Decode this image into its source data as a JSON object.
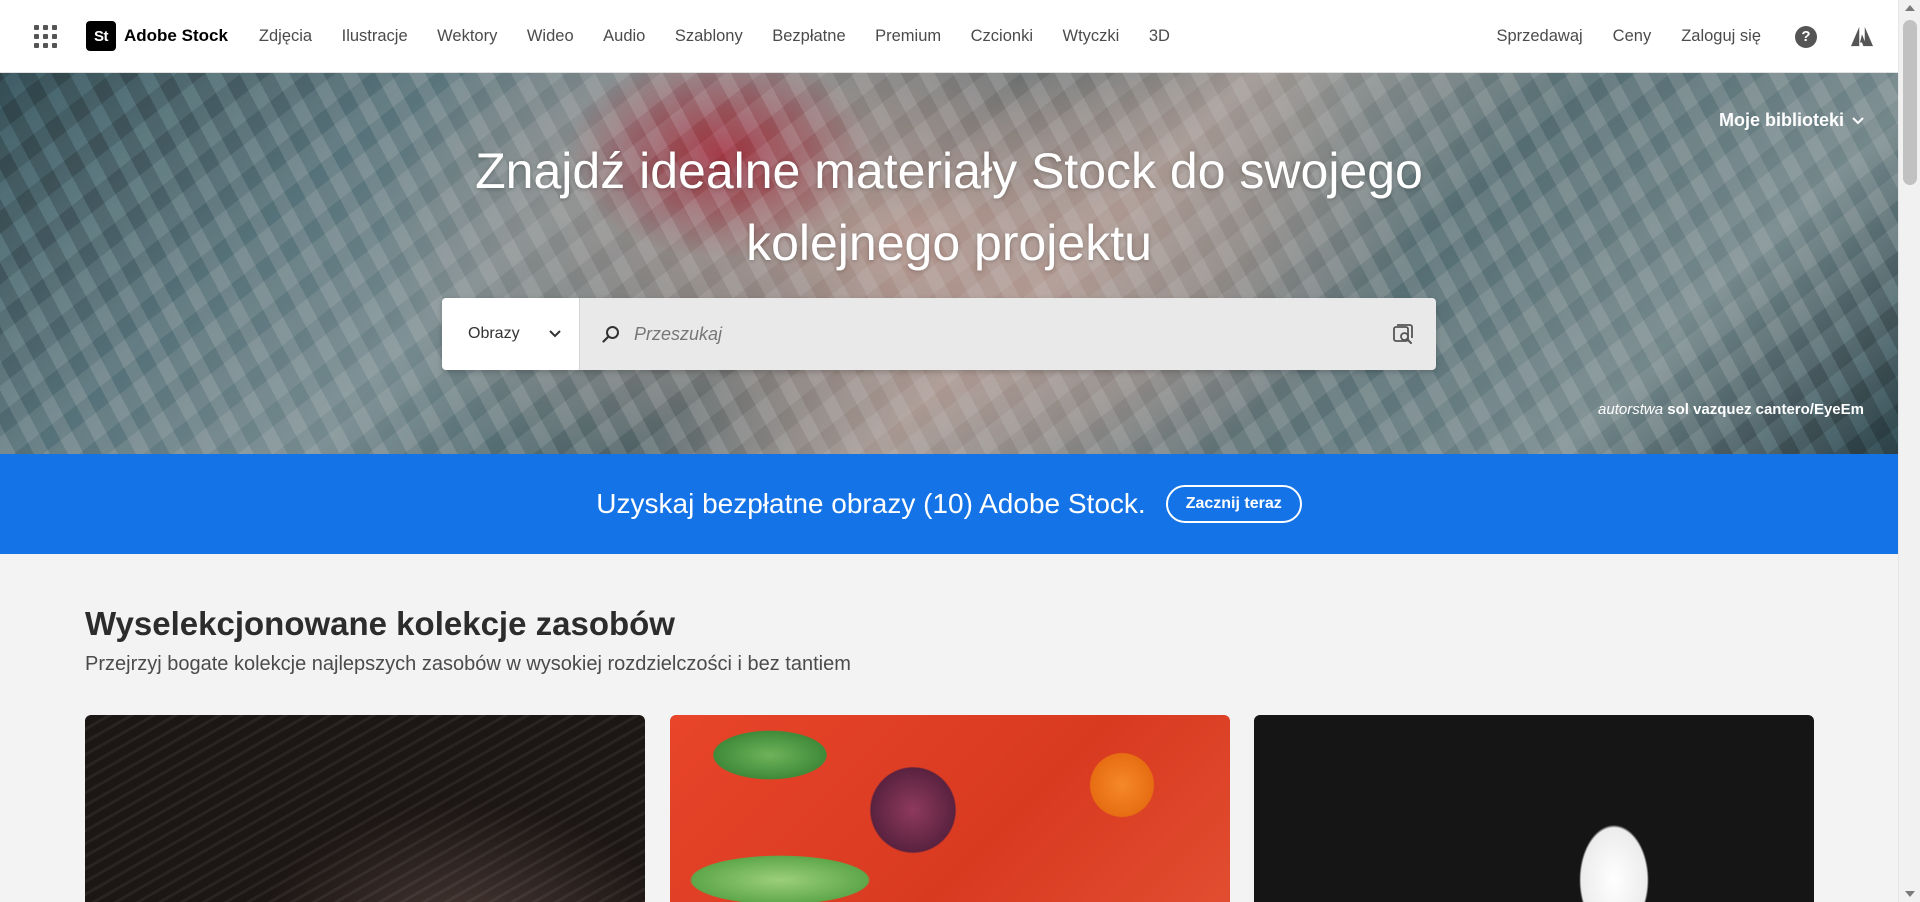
{
  "header": {
    "brand_logo": "St",
    "brand_name": "Adobe Stock",
    "nav": [
      "Zdjęcia",
      "Ilustracje",
      "Wektory",
      "Wideo",
      "Audio",
      "Szablony",
      "Bezpłatne",
      "Premium",
      "Czcionki",
      "Wtyczki",
      "3D"
    ],
    "right_nav": {
      "sell": "Sprzedawaj",
      "pricing": "Ceny",
      "sign_in": "Zaloguj się"
    },
    "help_icon": "question-circle-icon",
    "adobe_icon": "adobe-logo-icon"
  },
  "hero": {
    "libraries_label": "Moje biblioteki",
    "title_line1": "Znajdź idealne materiały Stock do swojego",
    "title_line2": "kolejnego projektu",
    "search": {
      "type_selected": "Obrazy",
      "placeholder": "Przeszukaj",
      "value": ""
    },
    "credit_prefix": "autorstwa",
    "credit_author": "sol vazquez cantero/EyeEm"
  },
  "promo": {
    "text": "Uzyskaj bezpłatne obrazy (10) Adobe Stock.",
    "button": "Zacznij teraz",
    "color": "#1473e6"
  },
  "collections": {
    "title": "Wyselekcjonowane kolekcje zasobów",
    "subtitle": "Przejrzyj bogate kolekcje najlepszych zasobów w wysokiej rozdzielczości i bez tantiem"
  }
}
